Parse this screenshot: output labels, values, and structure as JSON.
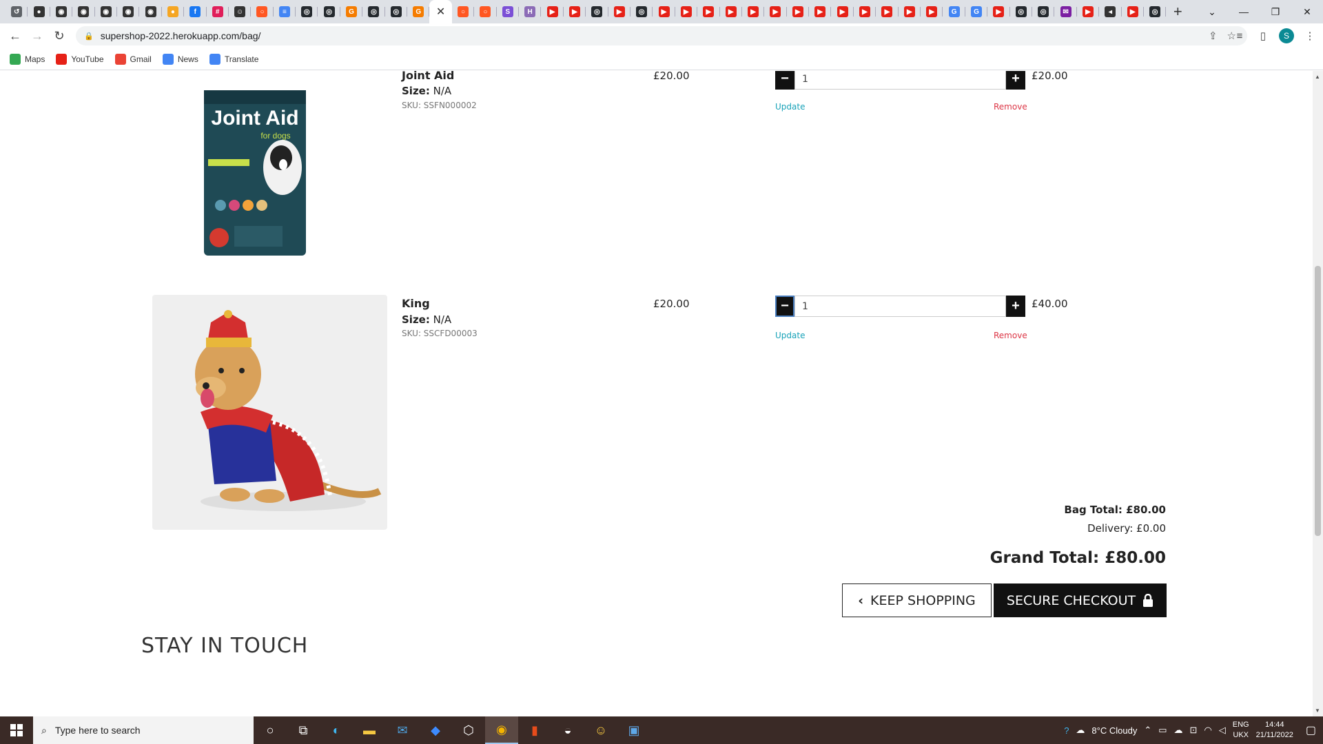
{
  "browser": {
    "tabs": [
      {
        "icon": "history-icon",
        "color": "#5f6368",
        "glyph": "↺"
      },
      {
        "icon": "dark-circle-icon",
        "color": "#333",
        "glyph": "●"
      },
      {
        "icon": "github-like-icon",
        "color": "#333",
        "glyph": "◉"
      },
      {
        "icon": "github-like-icon",
        "color": "#333",
        "glyph": "◉"
      },
      {
        "icon": "github-like-icon",
        "color": "#333",
        "glyph": "◉"
      },
      {
        "icon": "github-like-icon",
        "color": "#333",
        "glyph": "◉"
      },
      {
        "icon": "github-like-icon",
        "color": "#333",
        "glyph": "◉"
      },
      {
        "icon": "orange-dot-icon",
        "color": "#f5a623",
        "glyph": "●"
      },
      {
        "icon": "facebook-icon",
        "color": "#1877f2",
        "glyph": "f"
      },
      {
        "icon": "slack-icon",
        "color": "#e01e5a",
        "glyph": "#"
      },
      {
        "icon": "smiley-icon",
        "color": "#333",
        "glyph": "☺"
      },
      {
        "icon": "orange-ring-icon",
        "color": "#ff5722",
        "glyph": "○"
      },
      {
        "icon": "docs-icon",
        "color": "#4285f4",
        "glyph": "≡"
      },
      {
        "icon": "github-icon",
        "color": "#24292e",
        "glyph": "◎"
      },
      {
        "icon": "github-icon",
        "color": "#24292e",
        "glyph": "◎"
      },
      {
        "icon": "orange-g-icon",
        "color": "#f57c00",
        "glyph": "G"
      },
      {
        "icon": "github-icon",
        "color": "#24292e",
        "glyph": "◎"
      },
      {
        "icon": "github-icon",
        "color": "#24292e",
        "glyph": "◎"
      },
      {
        "icon": "orange-g-icon",
        "color": "#f57c00",
        "glyph": "G"
      },
      {
        "icon": "close-tab-icon",
        "color": "#333",
        "glyph": "✕",
        "active": true
      },
      {
        "icon": "orange-ring-icon",
        "color": "#ff5722",
        "glyph": "○"
      },
      {
        "icon": "orange-ring-icon",
        "color": "#ff5722",
        "glyph": "○"
      },
      {
        "icon": "s-badge-icon",
        "color": "#7b4fd6",
        "glyph": "S"
      },
      {
        "icon": "h-badge-icon",
        "color": "#8b6bb6",
        "glyph": "H"
      },
      {
        "icon": "youtube-icon",
        "color": "#e62117",
        "glyph": "▶"
      },
      {
        "icon": "youtube-icon",
        "color": "#e62117",
        "glyph": "▶"
      },
      {
        "icon": "github-icon",
        "color": "#24292e",
        "glyph": "◎"
      },
      {
        "icon": "youtube-icon",
        "color": "#e62117",
        "glyph": "▶"
      },
      {
        "icon": "github-icon",
        "color": "#24292e",
        "glyph": "◎"
      },
      {
        "icon": "youtube-icon",
        "color": "#e62117",
        "glyph": "▶"
      },
      {
        "icon": "youtube-icon",
        "color": "#e62117",
        "glyph": "▶"
      },
      {
        "icon": "youtube-icon",
        "color": "#e62117",
        "glyph": "▶"
      },
      {
        "icon": "youtube-icon",
        "color": "#e62117",
        "glyph": "▶"
      },
      {
        "icon": "youtube-icon",
        "color": "#e62117",
        "glyph": "▶"
      },
      {
        "icon": "youtube-icon",
        "color": "#e62117",
        "glyph": "▶"
      },
      {
        "icon": "youtube-icon",
        "color": "#e62117",
        "glyph": "▶"
      },
      {
        "icon": "youtube-icon",
        "color": "#e62117",
        "glyph": "▶"
      },
      {
        "icon": "youtube-icon",
        "color": "#e62117",
        "glyph": "▶"
      },
      {
        "icon": "youtube-icon",
        "color": "#e62117",
        "glyph": "▶"
      },
      {
        "icon": "youtube-icon",
        "color": "#e62117",
        "glyph": "▶"
      },
      {
        "icon": "youtube-icon",
        "color": "#e62117",
        "glyph": "▶"
      },
      {
        "icon": "youtube-icon",
        "color": "#e62117",
        "glyph": "▶"
      },
      {
        "icon": "google-icon",
        "color": "#4285f4",
        "glyph": "G"
      },
      {
        "icon": "google-icon",
        "color": "#4285f4",
        "glyph": "G"
      },
      {
        "icon": "youtube-icon",
        "color": "#e62117",
        "glyph": "▶"
      },
      {
        "icon": "github-icon",
        "color": "#24292e",
        "glyph": "◎"
      },
      {
        "icon": "github-icon",
        "color": "#24292e",
        "glyph": "◎"
      },
      {
        "icon": "mail-icon",
        "color": "#7b1fa2",
        "glyph": "✉"
      },
      {
        "icon": "youtube-icon",
        "color": "#e62117",
        "glyph": "▶"
      },
      {
        "icon": "audio-icon",
        "color": "#333",
        "glyph": "◂"
      },
      {
        "icon": "youtube-icon",
        "color": "#e62117",
        "glyph": "▶"
      },
      {
        "icon": "github-icon",
        "color": "#24292e",
        "glyph": "◎"
      }
    ],
    "url": "supershop-2022.herokuapp.com/bag/",
    "bookmarks": [
      {
        "label": "Maps",
        "icon": "maps-icon",
        "color": "#34a853"
      },
      {
        "label": "YouTube",
        "icon": "youtube-icon",
        "color": "#e62117"
      },
      {
        "label": "Gmail",
        "icon": "gmail-icon",
        "color": "#ea4335"
      },
      {
        "label": "News",
        "icon": "news-icon",
        "color": "#4285f4"
      },
      {
        "label": "Translate",
        "icon": "translate-icon",
        "color": "#4285f4"
      }
    ],
    "profile_initial": "S"
  },
  "bag": {
    "items": [
      {
        "name": "Joint Aid",
        "size_label": "Size:",
        "size": "N/A",
        "sku": "SKU: SSFN000002",
        "price": "£20.00",
        "qty": "1",
        "subtotal": "£20.00",
        "update": "Update",
        "remove": "Remove",
        "image_brand": "Joint Aid",
        "image_sub": "for dogs"
      },
      {
        "name": "King",
        "size_label": "Size:",
        "size": "N/A",
        "sku": "SKU: SSCFD00003",
        "price": "£20.00",
        "qty": "1",
        "subtotal": "£40.00",
        "update": "Update",
        "remove": "Remove"
      }
    ],
    "bag_total": "Bag Total: £80.00",
    "delivery": "Delivery: £0.00",
    "grand_total": "Grand Total: £80.00",
    "keep_shopping": "KEEP SHOPPING",
    "secure_checkout": "SECURE CHECKOUT",
    "footer_heading": "STAY IN TOUCH"
  },
  "taskbar": {
    "search_placeholder": "Type here to search",
    "weather": "8°C  Cloudy",
    "lang_top": "ENG",
    "lang_bottom": "UKX",
    "time": "14:44",
    "date": "21/11/2022"
  }
}
